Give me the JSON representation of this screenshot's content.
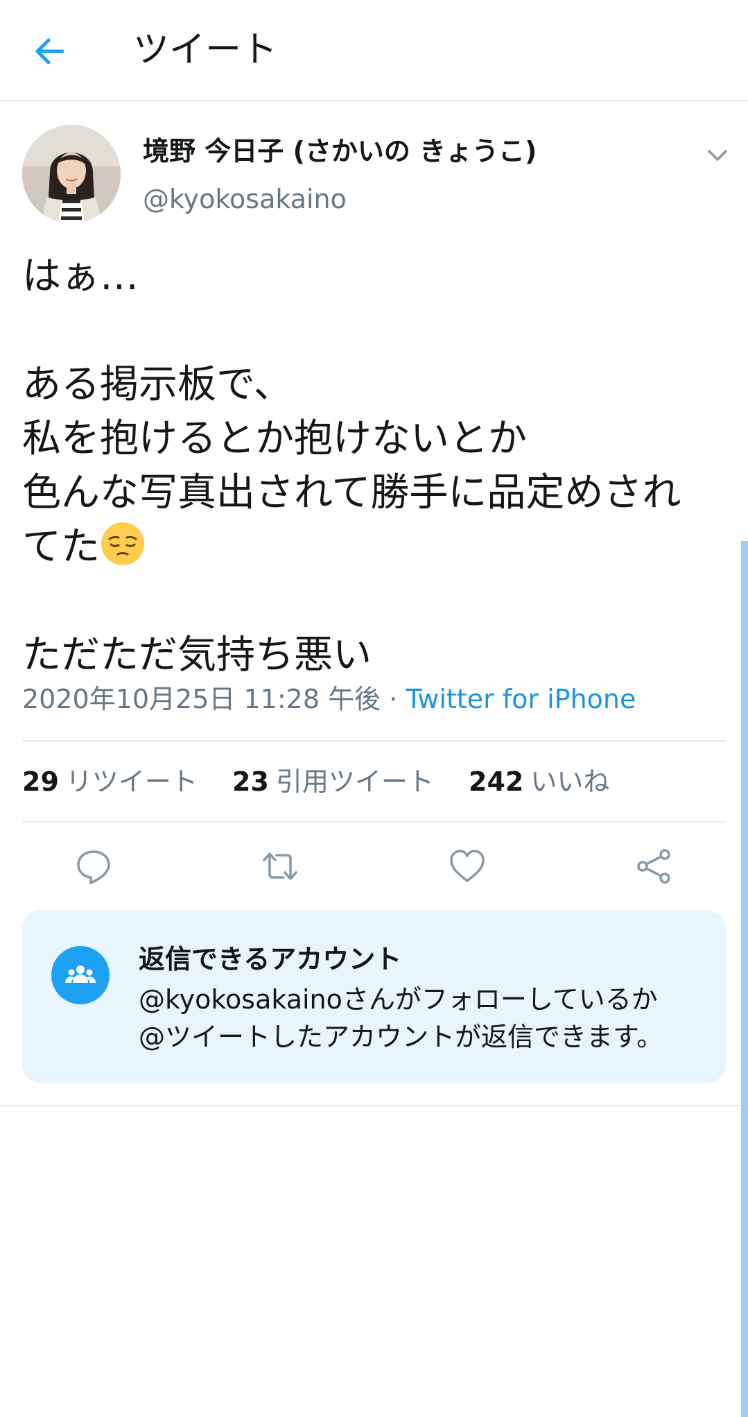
{
  "header": {
    "title": "ツイート",
    "back_icon": "arrow-left-icon"
  },
  "colors": {
    "accent": "#1da1f2",
    "link": "#1b95e0",
    "secondary_text": "#657786",
    "reply_card_bg": "#e8f5fd"
  },
  "tweet": {
    "display_name": "境野 今日子 (さかいの きょうこ)",
    "handle": "@kyokosakaino",
    "text_lines": {
      "l1": "はぁ…",
      "l2": "ある掲示板で、",
      "l3": "私を抱けるとか抱けないとか",
      "l4": "色んな写真出されて勝手に品定めされ",
      "l5": "てた",
      "l6": "ただただ気持ち悪い"
    },
    "emoji": "pensive-face-emoji",
    "timestamp": "2020年10月25日 11:28 午後",
    "separator": " · ",
    "source": "Twitter for iPhone"
  },
  "stats": {
    "retweets_count": "29",
    "retweets_label": "リツイート",
    "quotes_count": "23",
    "quotes_label": "引用ツイート",
    "likes_count": "242",
    "likes_label": "いいね"
  },
  "actions": [
    "reply-icon",
    "retweet-icon",
    "like-icon",
    "share-icon"
  ],
  "reply_settings": {
    "title": "返信できるアカウント",
    "line1": "@kyokosakainoさんがフォローしているか",
    "line2": "@ツイートしたアカウントが返信できます。",
    "icon": "people-icon"
  }
}
